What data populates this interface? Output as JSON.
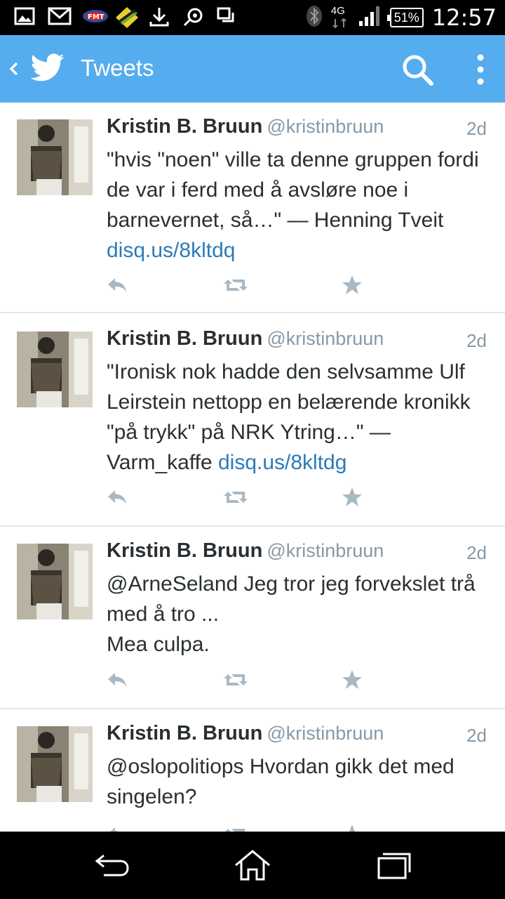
{
  "status_bar": {
    "network": "4G",
    "battery": "51%",
    "time": "12:57",
    "notification_icons": [
      "gallery-icon",
      "gmail-icon",
      "fmt-icon",
      "app-icon",
      "download-icon",
      "camera-icon",
      "window-icon"
    ]
  },
  "app_bar": {
    "title": "Tweets",
    "icons": [
      "back-icon",
      "twitter-bird-icon",
      "search-icon",
      "overflow-menu-icon"
    ],
    "color": "#55acee"
  },
  "tweets": [
    {
      "name": "Kristin B. Bruun",
      "handle": "@kristinbruun",
      "time": "2d",
      "text": "\"hvis \"noen\" ville ta denne gruppen fordi de var i ferd med å avsløre noe i barnevernet, så…\" — Henning Tveit",
      "link": "disq.us/8kltdq"
    },
    {
      "name": "Kristin B. Bruun",
      "handle": "@kristinbruun",
      "time": "2d",
      "text": "\"Ironisk nok hadde den selvsamme Ulf Leirstein nettopp en belærende kronikk \"på trykk\" på NRK Ytring…\" — Varm_kaffe",
      "link": "disq.us/8kltdg"
    },
    {
      "name": "Kristin B. Bruun",
      "handle": "@kristinbruun",
      "time": "2d",
      "text_lines": [
        "@ArneSeland Jeg tror jeg forvekslet trå med å tro ...",
        "Mea culpa."
      ]
    },
    {
      "name": "Kristin B. Bruun",
      "handle": "@kristinbruun",
      "time": "2d",
      "text": "@oslopolitiops Hvordan gikk det med singelen?"
    }
  ],
  "actions": [
    "reply-icon",
    "retweet-icon",
    "favorite-icon"
  ],
  "nav_bar": [
    "back-nav-icon",
    "home-nav-icon",
    "recents-nav-icon"
  ]
}
